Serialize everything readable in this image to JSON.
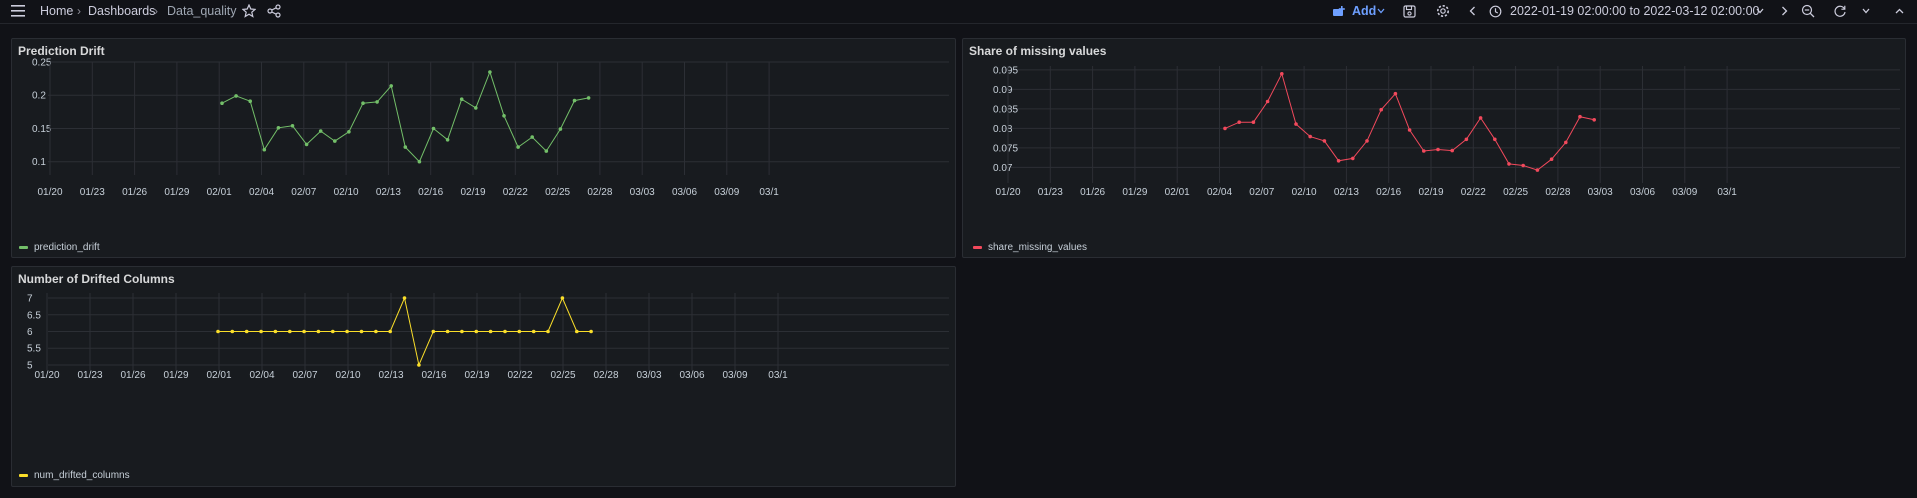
{
  "topbar": {
    "breadcrumb": {
      "home": "Home",
      "sep1": "›",
      "dashboards": "Dashboards",
      "sep2": "›",
      "current": "Data_quality"
    },
    "add_label": "Add",
    "time_range": "2022-01-19 02:00:00 to 2022-03-12 02:00:00"
  },
  "icons": {
    "menu": "menu-icon",
    "star": "star-icon",
    "share": "share-icon",
    "save": "save-icon",
    "settings": "gear-icon",
    "back": "chevron-left-icon",
    "clock": "clock-icon",
    "forward": "chevron-right-icon",
    "zoom_out": "zoom-out-icon",
    "refresh": "refresh-icon",
    "collapse": "chevron-up-icon"
  },
  "colors": {
    "accent": "#6e9fff",
    "green": "#73bf69",
    "red": "#f2495c",
    "yellow": "#fade2a"
  },
  "panels": {
    "prediction_drift": {
      "title": "Prediction Drift",
      "legend": "prediction_drift"
    },
    "missing_values": {
      "title": "Share of missing values",
      "legend": "share_missing_values"
    },
    "drifted_columns": {
      "title": "Number of Drifted Columns",
      "legend": "num_drifted_columns"
    }
  },
  "chart_data": [
    {
      "type": "line",
      "title": "Prediction Drift",
      "x_tick_labels": [
        "01/20",
        "01/23",
        "01/26",
        "01/29",
        "02/01",
        "02/04",
        "02/07",
        "02/10",
        "02/13",
        "02/16",
        "02/19",
        "02/22",
        "02/25",
        "02/28",
        "03/03",
        "03/06",
        "03/09",
        "03/1"
      ],
      "y_tick_labels": [
        "0.1",
        "0.15",
        "0.2",
        "0.25"
      ],
      "ylim": [
        0.08,
        0.25
      ],
      "series": [
        {
          "name": "prediction_drift",
          "color": "#73bf69",
          "x_day": [
            0,
            1,
            2,
            3,
            4,
            5,
            6,
            7,
            8,
            9,
            10,
            11,
            12,
            13,
            14,
            15,
            16,
            17,
            18,
            19,
            20,
            21,
            22,
            23,
            24,
            25,
            26
          ],
          "values": [
            0.188,
            0.199,
            0.191,
            0.118,
            0.151,
            0.154,
            0.126,
            0.146,
            0.131,
            0.145,
            0.188,
            0.19,
            0.214,
            0.122,
            0.1,
            0.15,
            0.133,
            0.194,
            0.181,
            0.235,
            0.169,
            0.122,
            0.137,
            0.116,
            0.149,
            0.192,
            0.196
          ]
        }
      ]
    },
    {
      "type": "line",
      "title": "Share of missing values",
      "x_tick_labels": [
        "01/20",
        "01/23",
        "01/26",
        "01/29",
        "02/01",
        "02/04",
        "02/07",
        "02/10",
        "02/13",
        "02/16",
        "02/19",
        "02/22",
        "02/25",
        "02/28",
        "03/03",
        "03/06",
        "03/09",
        "03/1"
      ],
      "y_tick_labels": [
        "0.07",
        "0.075",
        "0.08",
        "0.085",
        "0.09",
        "0.095"
      ],
      "ylim": [
        0.066,
        0.096
      ],
      "series": [
        {
          "name": "share_missing_values",
          "color": "#f2495c",
          "x_day": [
            0,
            1,
            2,
            3,
            4,
            5,
            6,
            7,
            8,
            9,
            10,
            11,
            12,
            13,
            14,
            15,
            16,
            17,
            18,
            19,
            20,
            21,
            22,
            23,
            24,
            25,
            26,
            27
          ],
          "values": [
            0.08,
            0.0816,
            0.0816,
            0.0869,
            0.094,
            0.0811,
            0.0779,
            0.0768,
            0.0717,
            0.0723,
            0.0768,
            0.0848,
            0.0889,
            0.0796,
            0.0742,
            0.0746,
            0.0743,
            0.0772,
            0.0827,
            0.0772,
            0.0709,
            0.0705,
            0.0693,
            0.0721,
            0.0764,
            0.083,
            0.0822
          ]
        }
      ]
    },
    {
      "type": "line",
      "title": "Number of Drifted Columns",
      "x_tick_labels": [
        "01/20",
        "01/23",
        "01/26",
        "01/29",
        "02/01",
        "02/04",
        "02/07",
        "02/10",
        "02/13",
        "02/16",
        "02/19",
        "02/22",
        "02/25",
        "02/28",
        "03/03",
        "03/06",
        "03/09",
        "03/1"
      ],
      "y_tick_labels": [
        "5",
        "5.5",
        "6",
        "6.5",
        "7"
      ],
      "ylim": [
        4.85,
        7.15
      ],
      "series": [
        {
          "name": "num_drifted_columns",
          "color": "#fade2a",
          "x_day": [
            0,
            1,
            2,
            3,
            4,
            5,
            6,
            7,
            8,
            9,
            10,
            11,
            12,
            13,
            14,
            15,
            16,
            17,
            18,
            19,
            20,
            21,
            22,
            23,
            24,
            25,
            26
          ],
          "values": [
            6,
            6,
            6,
            6,
            6,
            6,
            6,
            6,
            6,
            6,
            6,
            6,
            6,
            7,
            5,
            6,
            6,
            6,
            6,
            6,
            6,
            6,
            6,
            6,
            7,
            6,
            6
          ]
        }
      ]
    }
  ]
}
